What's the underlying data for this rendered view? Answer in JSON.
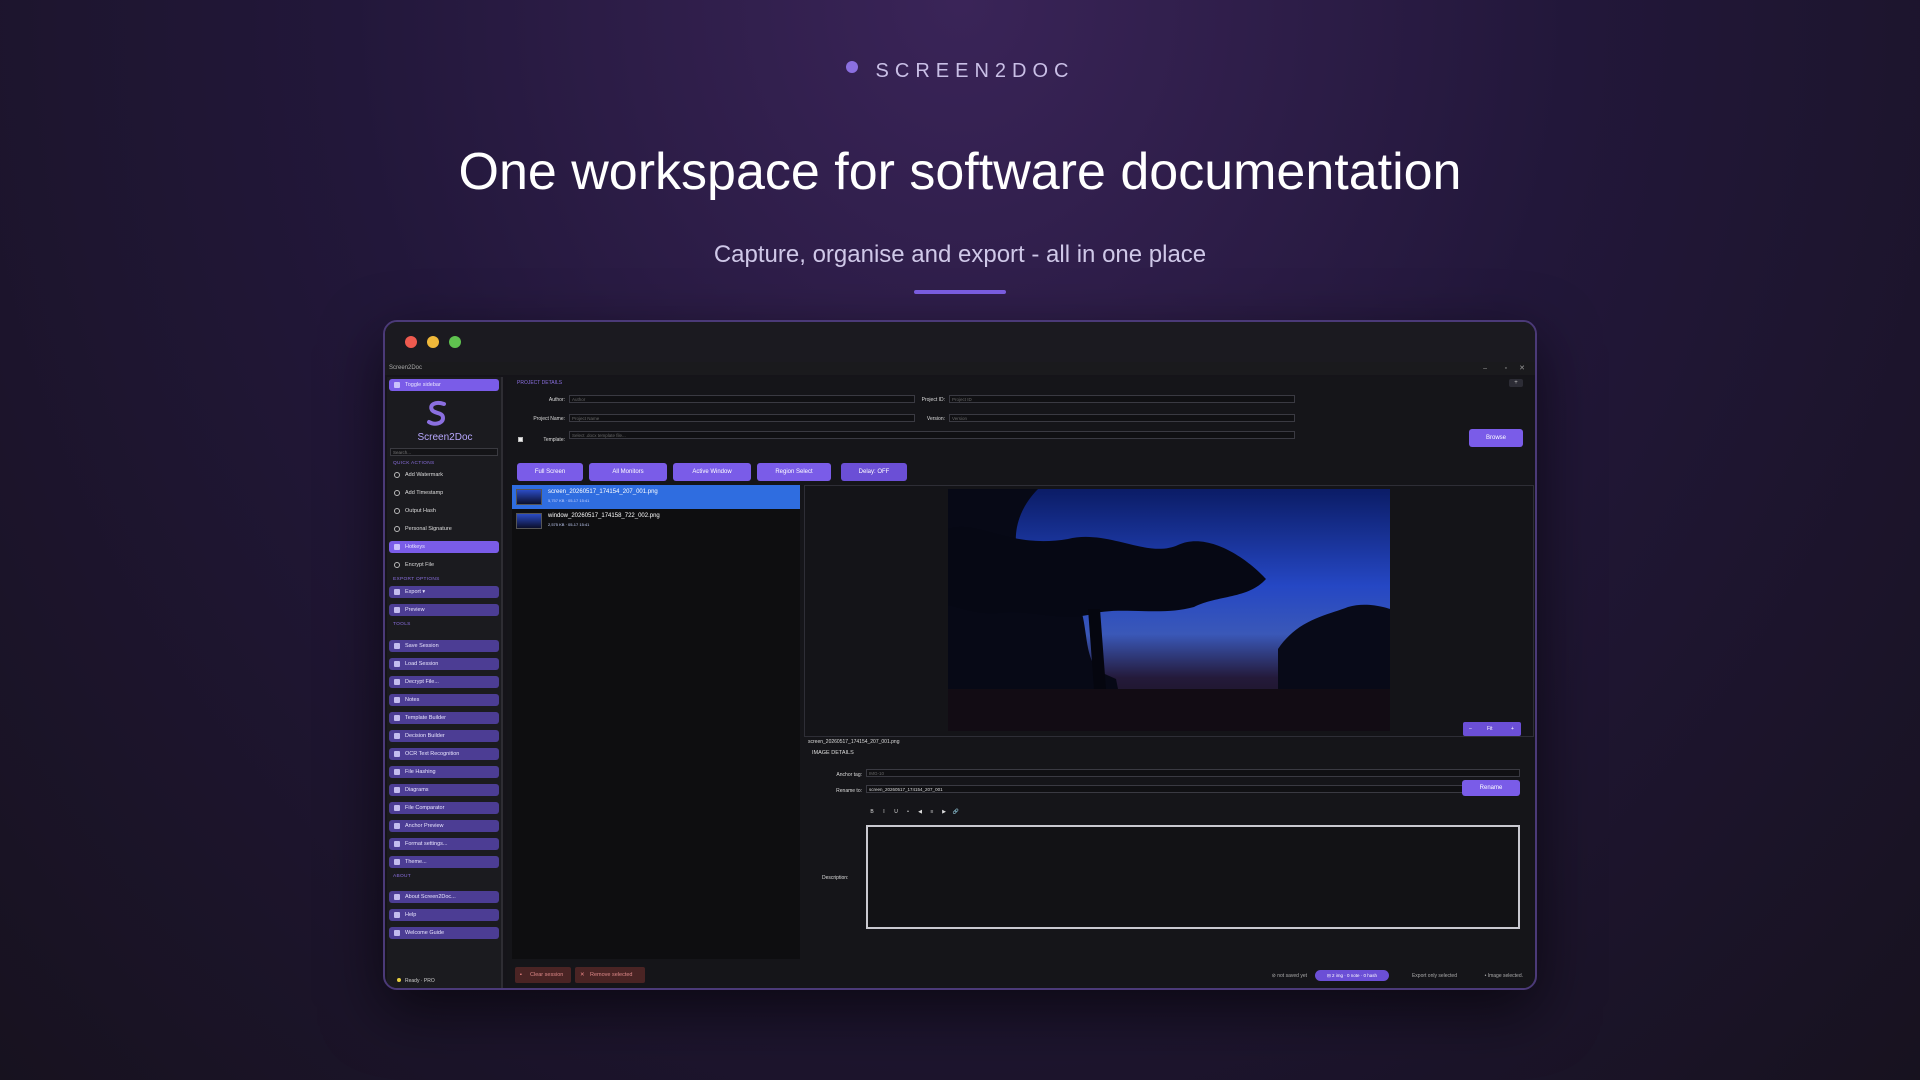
{
  "hero": {
    "brand": "SCREEN2DOC",
    "headline": "One workspace for software documentation",
    "subline": "Capture, organise and export - all in one place"
  },
  "window": {
    "title": "Screen2Doc",
    "controls": {
      "minimize": "–",
      "maximize": "▫",
      "close": "✕"
    }
  },
  "sidebar": {
    "toggle": "Toggle sidebar",
    "app_name": "Screen2Doc",
    "search_placeholder": "Search...",
    "quick_actions_head": "QUICK ACTIONS",
    "quick_actions": [
      "Add Watermark",
      "Add Timestamp",
      "Output Hash",
      "Personal Signature",
      "Hotkeys",
      "Encrypt File"
    ],
    "export_head": "EXPORT OPTIONS",
    "export": [
      "Export ▾",
      "Preview"
    ],
    "tools_head": "TOOLS",
    "tools": [
      "Save Session",
      "Load Session",
      "Decrypt File...",
      "Notes",
      "Template Builder",
      "Decision Builder",
      "OCR Text Recognition",
      "File Hashing",
      "Diagrams",
      "File Comparator",
      "Anchor Preview",
      "Format settings...",
      "Theme..."
    ],
    "about_head": "ABOUT",
    "about": [
      "About Screen2Doc...",
      "Help",
      "Welcome Guide"
    ],
    "status": "Ready · PRO"
  },
  "project": {
    "title": "PROJECT DETAILS",
    "plus": "+",
    "author_label": "Author:",
    "author_placeholder": "Author",
    "project_id_label": "Project ID:",
    "project_id_placeholder": "Project ID",
    "project_name_label": "Project Name:",
    "project_name_placeholder": "Project Name",
    "version_label": "Version:",
    "version_placeholder": "Version",
    "template_label": "Template:",
    "template_placeholder": "Select .docx template file...",
    "browse": "Browse"
  },
  "capture": {
    "full_screen": "Full Screen",
    "all_monitors": "All Monitors",
    "active_window": "Active Window",
    "region_select": "Region Select",
    "delay": "Delay: OFF"
  },
  "files": [
    {
      "name": "screen_20260517_174154_207_001.png",
      "meta": "5,757 KB · 05-17 15:41"
    },
    {
      "name": "window_20260517_174158_722_002.png",
      "meta": "2,575 KB · 05-17 15:41"
    }
  ],
  "preview": {
    "caption": "screen_20260517_174154_207_001.png",
    "zoom_minus": "–",
    "zoom_fit": "Fit",
    "zoom_plus": "+"
  },
  "image_details": {
    "title": "IMAGE DETAILS",
    "anchor_label": "Anchor tag:",
    "anchor_placeholder": "IMG-10",
    "rename_label": "Rename to:",
    "rename_value": "screen_20260517_174154_207_001",
    "rename_button": "Rename",
    "toolbar": [
      "B",
      "I",
      "U",
      "•",
      "◀",
      "≡",
      "▶",
      "🔗"
    ],
    "description_label": "Description:"
  },
  "footer": {
    "clear": "Clear session",
    "remove": "Remove selected",
    "saved": "⊘ not saved yet",
    "counts": "⊟ 2 img · 0 note · 0 hash",
    "export_only": "Export only selected",
    "selected": "• Image selected."
  }
}
